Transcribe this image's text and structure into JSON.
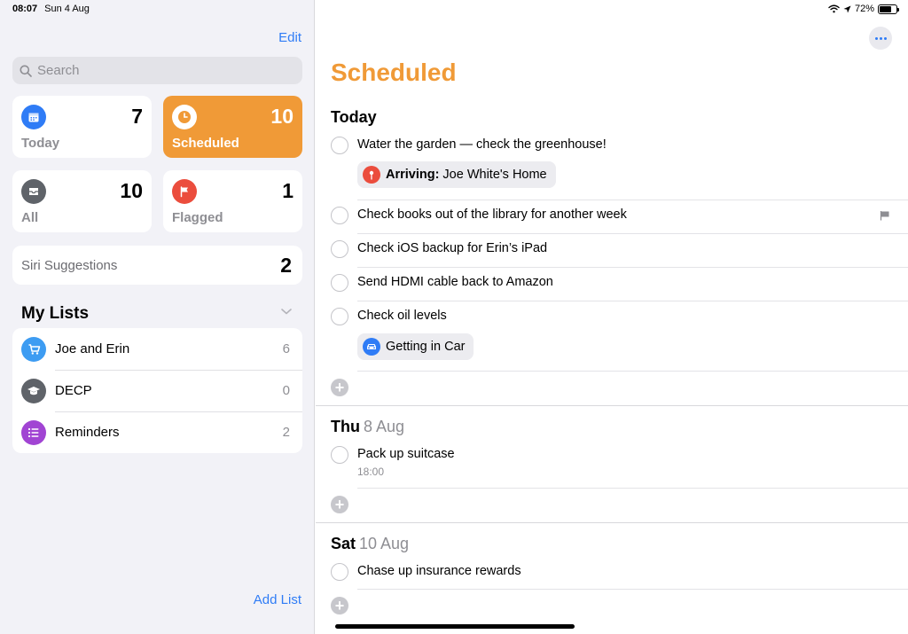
{
  "status": {
    "time": "08:07",
    "date": "Sun 4 Aug",
    "battery": "72%",
    "battery_level": 0.72
  },
  "sidebar": {
    "edit": "Edit",
    "search_placeholder": "Search",
    "smart_lists": [
      {
        "label": "Today",
        "count": "7",
        "icon": "calendar-icon",
        "color": "#2f7cf6"
      },
      {
        "label": "Scheduled",
        "count": "10",
        "icon": "clock-icon",
        "color": "#f09a37",
        "active": true
      },
      {
        "label": "All",
        "count": "10",
        "icon": "tray-icon",
        "color": "#5f6369"
      },
      {
        "label": "Flagged",
        "count": "1",
        "icon": "flag-icon",
        "color": "#eb4d3d"
      }
    ],
    "siri": {
      "label": "Siri Suggestions",
      "count": "2"
    },
    "my_lists_title": "My Lists",
    "lists": [
      {
        "name": "Joe and Erin",
        "count": "6",
        "icon": "cart-icon",
        "color": "#3d9cf2"
      },
      {
        "name": "DECP",
        "count": "0",
        "icon": "graduation-cap-icon",
        "color": "#5f6369"
      },
      {
        "name": "Reminders",
        "count": "2",
        "icon": "list-icon",
        "color": "#a144d3"
      }
    ],
    "add_list": "Add List"
  },
  "main": {
    "title": "Scheduled",
    "sections": [
      {
        "day": "Today",
        "date": "",
        "tasks": [
          {
            "title": "Water the garden — check the greenhouse!",
            "pill_bold": "Arriving:",
            "pill_text": "Joe White's Home",
            "pill_icon": "location-pin-icon",
            "pill_color": "#eb4d3d"
          },
          {
            "title": "Check books out of the library for another week",
            "flagged": true
          },
          {
            "title": "Check iOS backup for Erin’s iPad"
          },
          {
            "title": "Send HDMI cable back to Amazon"
          },
          {
            "title": "Check oil levels",
            "pill_text": "Getting in Car",
            "pill_icon": "car-icon",
            "pill_color": "#2f7cf6"
          }
        ]
      },
      {
        "day": "Thu",
        "date": "8 Aug",
        "tasks": [
          {
            "title": "Pack up suitcase",
            "time": "18:00"
          }
        ]
      },
      {
        "day": "Sat",
        "date": "10 Aug",
        "tasks": [
          {
            "title": "Chase up insurance rewards"
          }
        ]
      }
    ]
  }
}
